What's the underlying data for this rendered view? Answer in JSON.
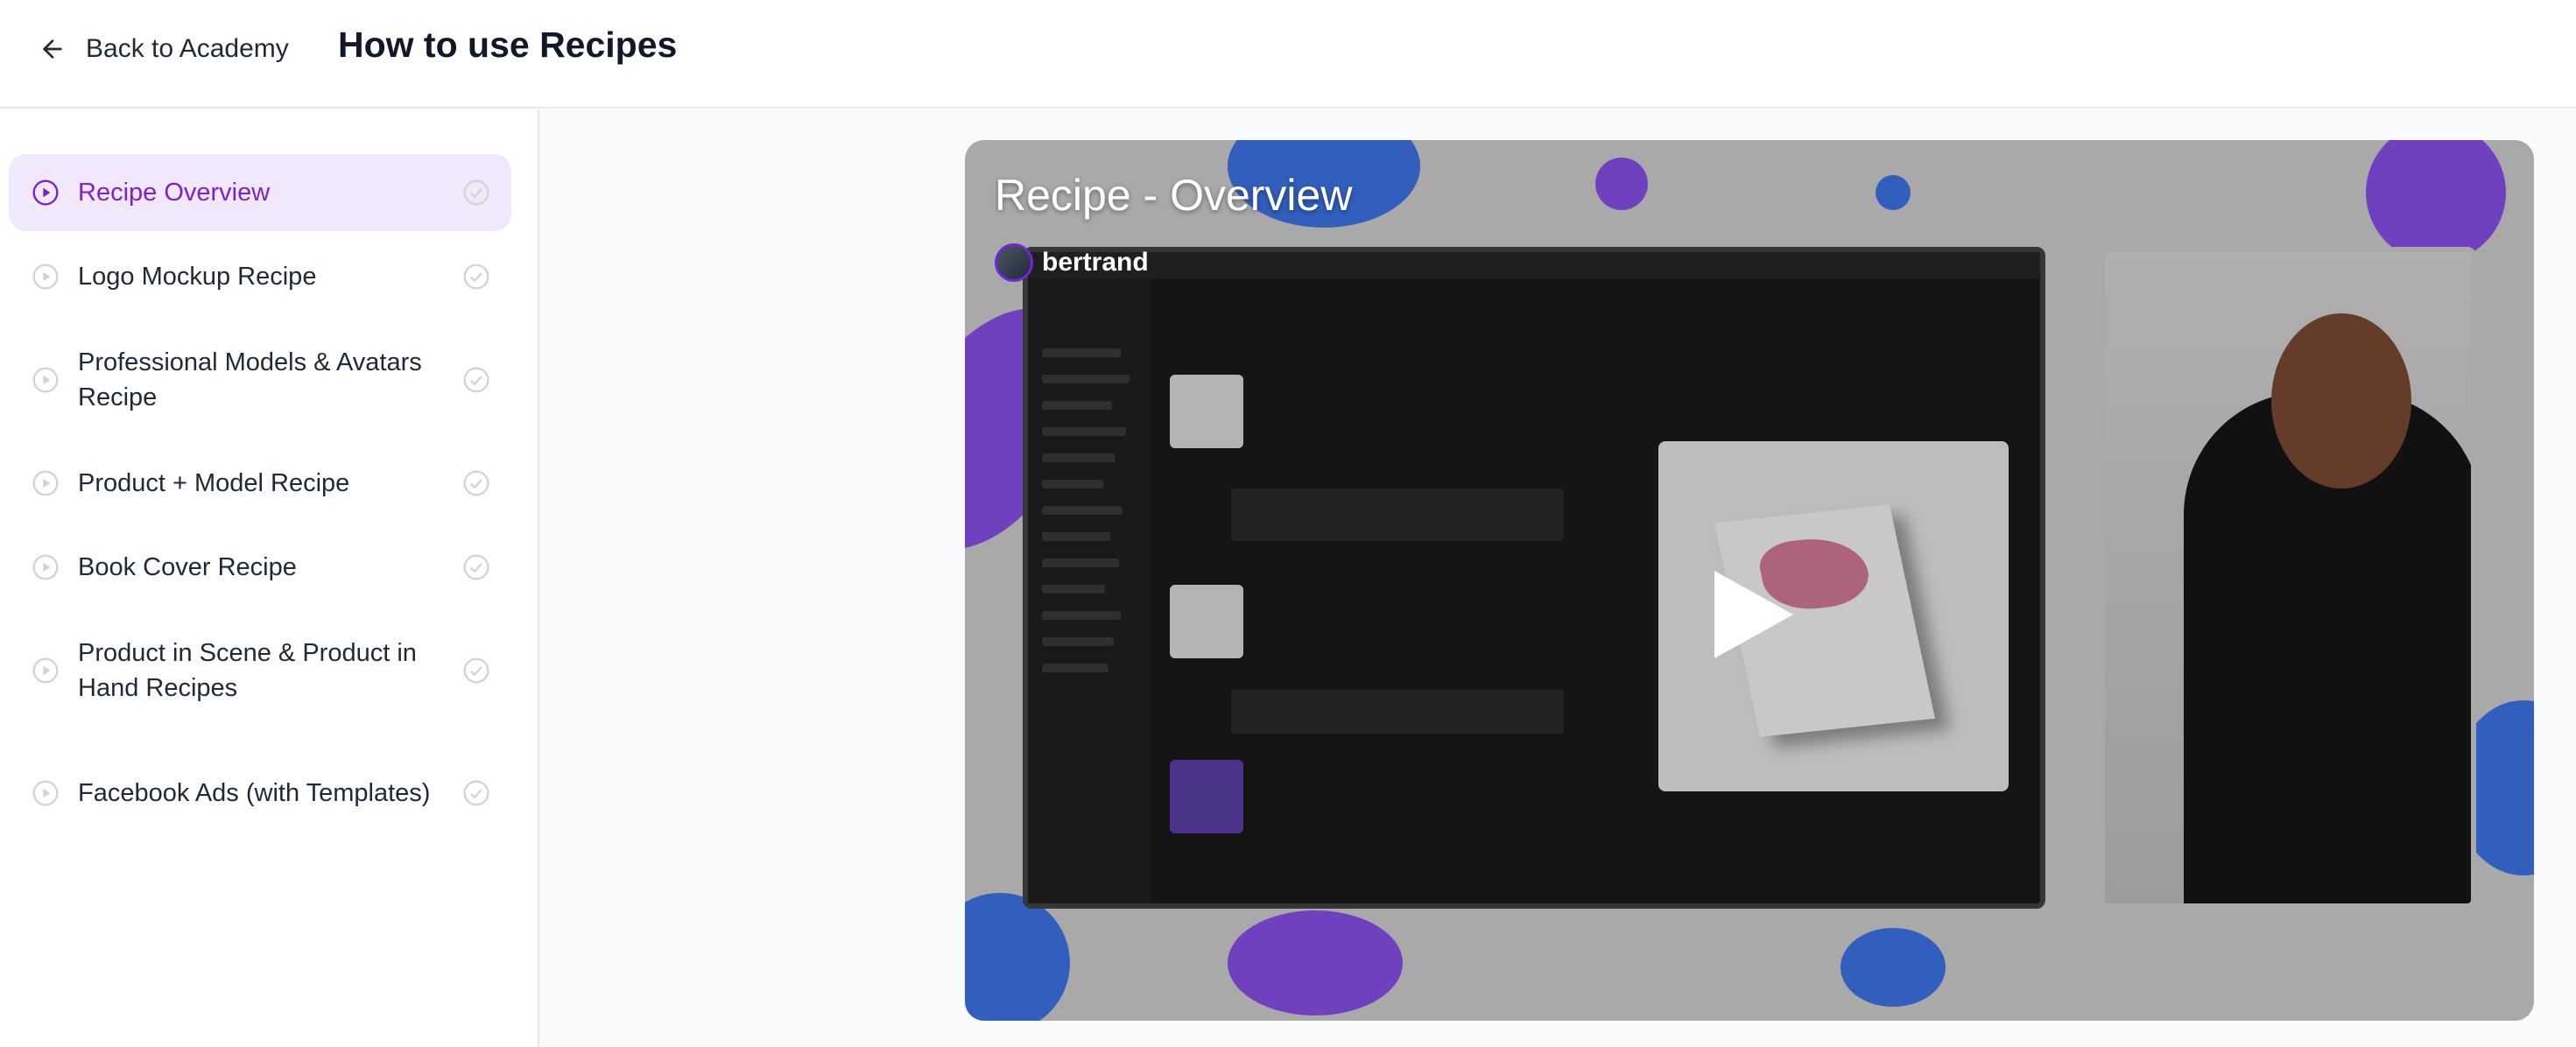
{
  "header": {
    "back_label": "Back to Academy",
    "title": "How to use Recipes"
  },
  "sidebar": {
    "lessons": [
      {
        "label": "Recipe Overview",
        "active": true
      },
      {
        "label": "Logo Mockup Recipe",
        "active": false
      },
      {
        "label": "Professional Models & Avatars Recipe",
        "active": false
      },
      {
        "label": "Product + Model Recipe",
        "active": false
      },
      {
        "label": "Book Cover Recipe",
        "active": false
      },
      {
        "label": "Product in Scene & Product in Hand Recipes",
        "active": false
      },
      {
        "label": "Facebook Ads (with Templates)",
        "active": false
      }
    ]
  },
  "video": {
    "title": "Recipe - Overview",
    "channel": "bertrand"
  },
  "colors": {
    "accent": "#7e22ce",
    "active_bg": "#f1e8fb",
    "icon_gray": "#d1d5db"
  }
}
